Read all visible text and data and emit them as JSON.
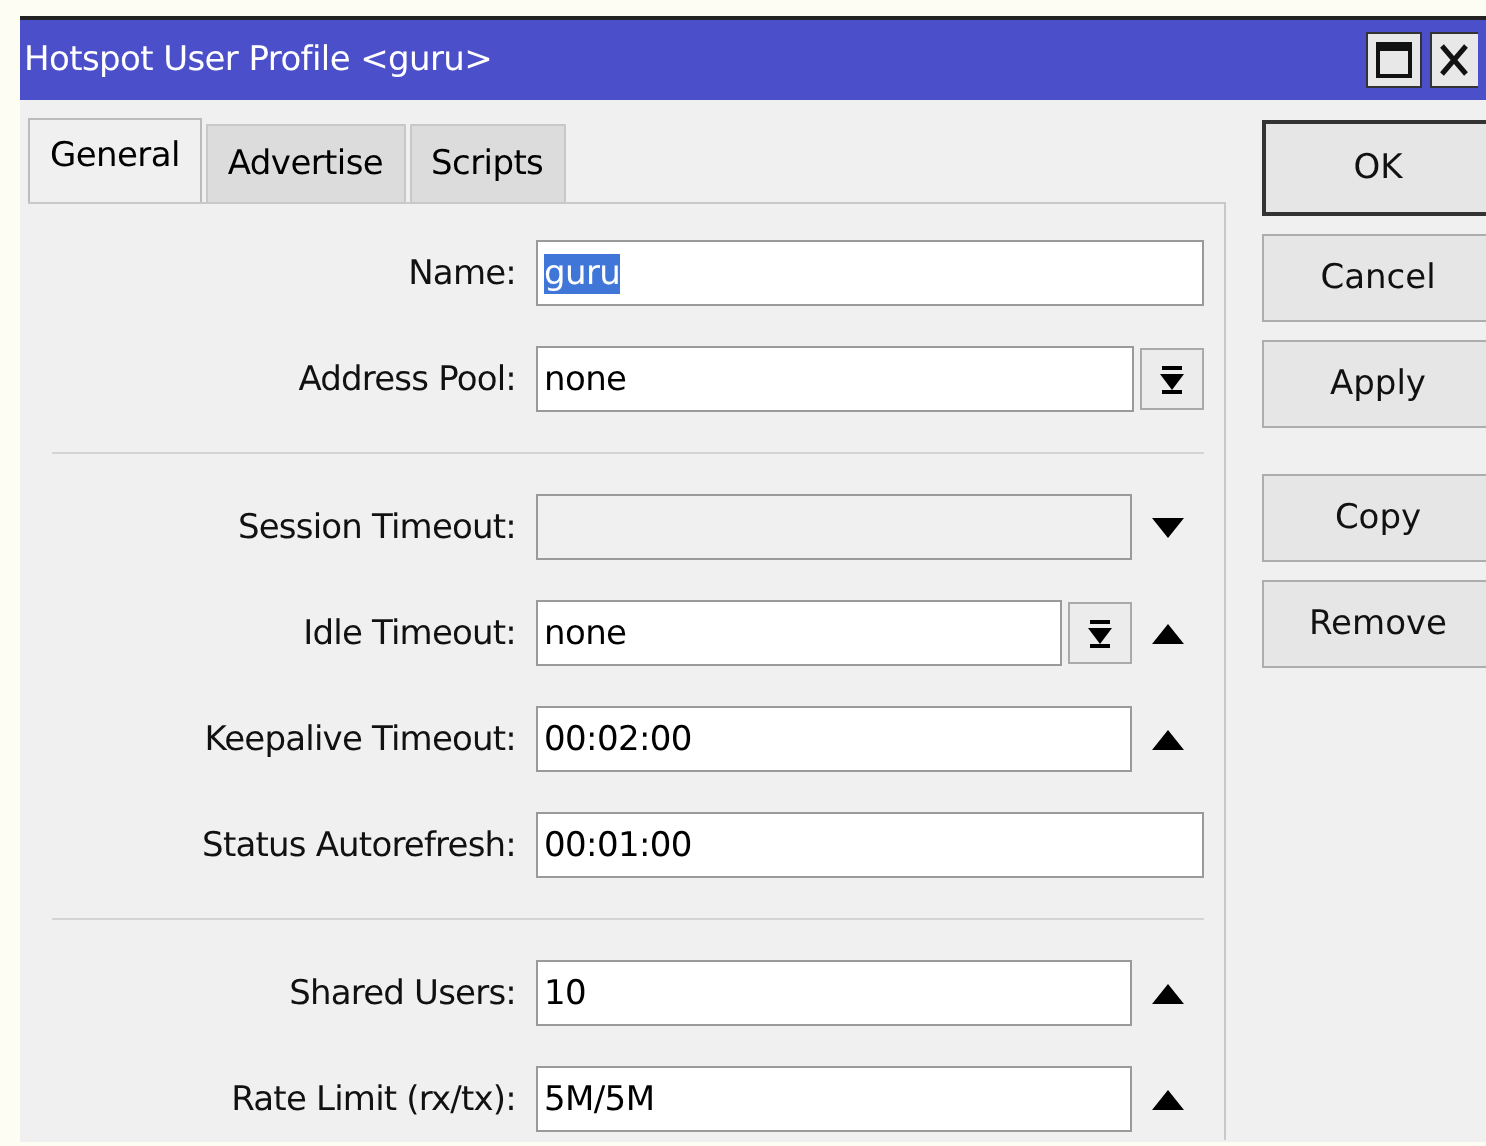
{
  "window": {
    "title": "Hotspot User Profile <guru>"
  },
  "tabs": [
    {
      "label": "General",
      "selected": true
    },
    {
      "label": "Advertise",
      "selected": false
    },
    {
      "label": "Scripts",
      "selected": false
    }
  ],
  "sections": [
    {
      "fields": [
        {
          "label": "Name:",
          "kind": "text",
          "value": "guru",
          "selected": true
        },
        {
          "label": "Address Pool:",
          "kind": "dropdown",
          "value": "none",
          "selected": false
        }
      ]
    },
    {
      "fields": [
        {
          "label": "Session Timeout:",
          "kind": "text",
          "disabled": true,
          "selected": false,
          "expanded": false
        },
        {
          "label": "Idle Timeout:",
          "kind": "dropdown",
          "value": "none",
          "selected": false,
          "expanded": true
        },
        {
          "label": "Keepalive Timeout:",
          "kind": "text",
          "value": "00:02:00",
          "selected": false,
          "expanded": true
        },
        {
          "label": "Status Autorefresh:",
          "kind": "text",
          "value": "00:01:00",
          "selected": false
        }
      ]
    },
    {
      "fields": [
        {
          "label": "Shared Users:",
          "kind": "text",
          "value": "10",
          "selected": false,
          "expanded": true
        },
        {
          "label": "Rate Limit (rx/tx):",
          "kind": "text",
          "value": "5M/5M",
          "selected": false,
          "expanded": true
        }
      ]
    }
  ],
  "button_groups": [
    [
      {
        "label": "OK",
        "default": true
      },
      {
        "label": "Cancel",
        "default": false
      },
      {
        "label": "Apply",
        "default": false
      }
    ],
    [
      {
        "label": "Copy",
        "default": false
      },
      {
        "label": "Remove",
        "default": false
      }
    ]
  ]
}
